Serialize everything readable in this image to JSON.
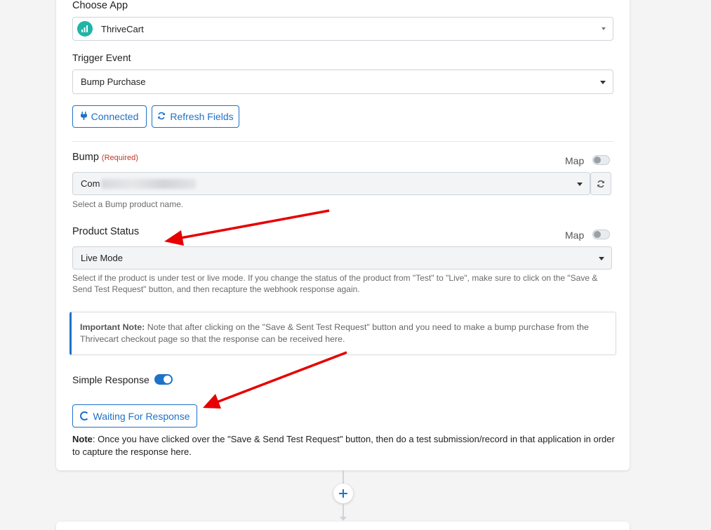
{
  "choose_app": {
    "label": "Choose App",
    "selected": "ThriveCart",
    "icon": "thrivecart-logo-icon",
    "accent": "#1fb5a8"
  },
  "trigger_event": {
    "label": "Trigger Event",
    "selected": "Bump Purchase"
  },
  "buttons": {
    "connected": "Connected",
    "refresh_fields": "Refresh Fields"
  },
  "bump": {
    "label": "Bump",
    "required": "(Required)",
    "map_label": "Map",
    "value_prefix": "Com",
    "help": "Select a Bump product name."
  },
  "product_status": {
    "label": "Product Status",
    "map_label": "Map",
    "selected": "Live Mode",
    "help": "Select if the product is under test or live mode. If you change the status of the product from \"Test\" to \"Live\", make sure to click on the \"Save & Send Test Request\" button, and then recapture the webhook response again."
  },
  "important_note": {
    "title": "Important Note:",
    "text": "Note that after clicking on the \"Save & Sent Test Request\" button and you need to make a bump purchase from the Thrivecart checkout page so that the response can be received here."
  },
  "simple_response": {
    "label": "Simple Response",
    "enabled": true
  },
  "waiting_button": "Waiting For Response",
  "footer_note": {
    "title": "Note",
    "text": ": Once you have clicked over the \"Save & Send Test Request\" button, then do a test submission/record in that application in order to capture the response here."
  },
  "colors": {
    "primary": "#1e72c7",
    "required": "#c0392b",
    "arrow": "#e60000"
  }
}
